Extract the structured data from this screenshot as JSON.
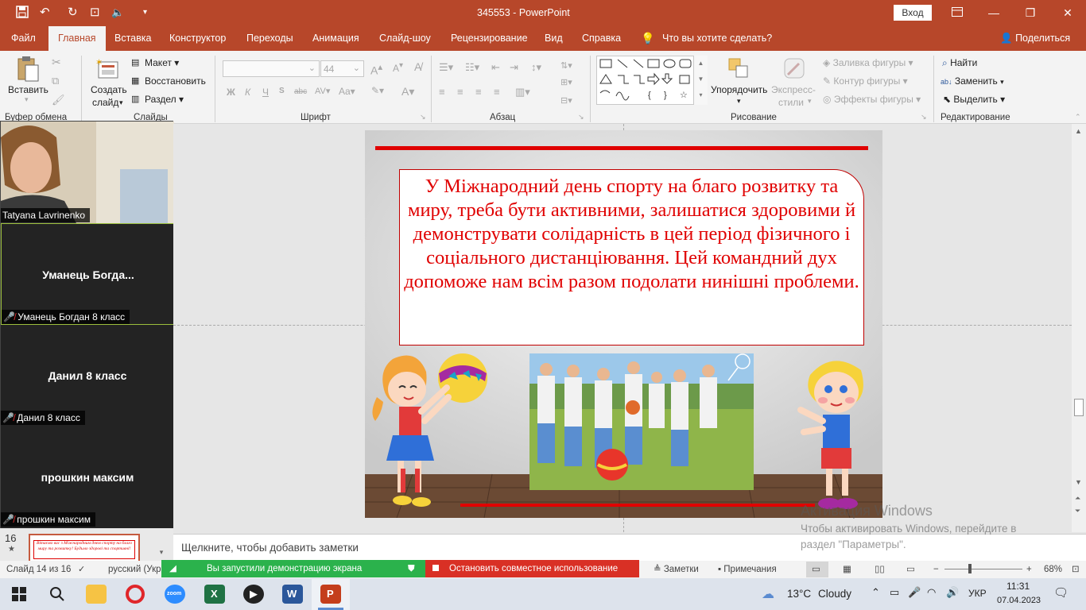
{
  "window": {
    "title": "345553 - PowerPoint",
    "signin": "Вход",
    "minimize": "—",
    "restore": "❐",
    "close": "✕"
  },
  "quick_access": {
    "save": "💾",
    "undo": "↶",
    "redo": "↻",
    "present": "⊡",
    "audio": "🔈"
  },
  "tabs": [
    "Файл",
    "Главная",
    "Вставка",
    "Конструктор",
    "Переходы",
    "Анимация",
    "Слайд-шоу",
    "Рецензирование",
    "Вид",
    "Справка"
  ],
  "tell_me": "Что вы хотите сделать?",
  "share": "Поделиться",
  "ribbon": {
    "clipboard": {
      "paste": "Вставить",
      "group": "Буфер обмена"
    },
    "slides": {
      "new_line1": "Создать",
      "new_line2": "слайд",
      "layout": "Макет",
      "reset": "Восстановить",
      "section": "Раздел",
      "group": "Слайды"
    },
    "font": {
      "size": "44",
      "bold": "Ж",
      "italic": "К",
      "underline": "Ч",
      "strike": "abc",
      "group": "Шрифт"
    },
    "paragraph": {
      "group": "Абзац"
    },
    "drawing": {
      "arrange": "Упорядочить",
      "styles_line1": "Экспресс-",
      "styles_line2": "стили",
      "fill": "Заливка фигуры",
      "outline": "Контур фигуры",
      "effects": "Эффекты фигуры",
      "group": "Рисование"
    },
    "editing": {
      "find": "Найти",
      "replace": "Заменить",
      "select": "Выделить",
      "group": "Редактирование"
    }
  },
  "zoom_panel": {
    "tiles": [
      {
        "name": "",
        "label": "Tatyana Lavrinenko"
      },
      {
        "name": "Уманець  Богда...",
        "label": "Уманець Богдан 8 класс"
      },
      {
        "name": "Данил 8 класс",
        "label": "Данил 8 класс"
      },
      {
        "name": "прошкин максим",
        "label": "прошкин максим"
      }
    ]
  },
  "thumbnail": {
    "number": "16",
    "star": "★",
    "text": "Вітаємо вас з Міжнародним днем спорту на благо миру та розвитку! Будьмо здорові та спортивні!"
  },
  "slide": {
    "main_text": "У Міжнародний день спорту на благо розвитку та миру, треба бути активними, залишатися здоровими й демонструвати солідарність в цей період фізичного і соціального дистанціювання. Цей командний дух допоможе нам всім разом подолати нинішні проблеми."
  },
  "notes_placeholder": "Щелкните, чтобы добавить заметки",
  "watermark": {
    "line1": "Активация Windows",
    "line2": "Чтобы активировать Windows, перейдите в",
    "line3": "раздел \"Параметры\"."
  },
  "status": {
    "slide_info": "Слайд 14 из 16",
    "language": "русский (Укр",
    "share_msg": "Вы запустили демонстрацию экрана",
    "stop_share": "Остановить совместное использование",
    "notes": "Заметки",
    "comments": "Примечания",
    "zoom": "68%"
  },
  "taskbar": {
    "weather_temp": "13°C",
    "weather_desc": "Cloudy",
    "lang": "УКР",
    "time": "11:31",
    "date": "07.04.2023"
  },
  "colors": {
    "accent": "#b7472a",
    "slide_text": "#e00000",
    "share_green": "#2bb24c",
    "share_red": "#d93025"
  }
}
